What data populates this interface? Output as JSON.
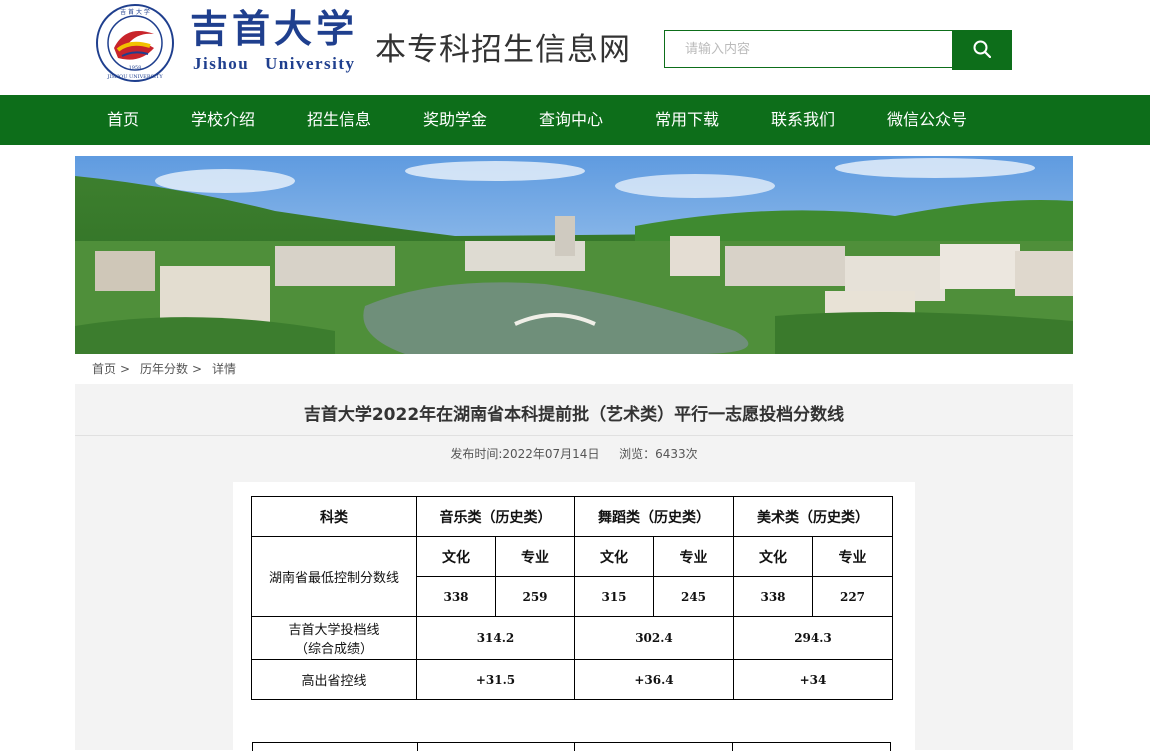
{
  "header": {
    "logo_cn": "吉首大学",
    "logo_en": "Jishou University",
    "site_title": "本专科招生信息网",
    "search_placeholder": "请输入内容",
    "search_icon": "search-icon"
  },
  "nav": {
    "items": [
      "首页",
      "学校介绍",
      "招生信息",
      "奖助学金",
      "查询中心",
      "常用下载",
      "联系我们",
      "微信公众号"
    ]
  },
  "breadcrumb": [
    "首页",
    "历年分数",
    "详情"
  ],
  "breadcrumb_separator": ">",
  "article": {
    "title": "吉首大学2022年在湖南省本科提前批（艺术类）平行一志愿投档分数线",
    "publish_label": "发布时间:",
    "publish_date": "2022年07月14日",
    "views_label": "浏览：",
    "views_count": "6433",
    "views_unit": "次"
  },
  "score_table": {
    "col_header": "科类",
    "categories": [
      "音乐类（历史类）",
      "舞蹈类（历史类）",
      "美术类（历史类）"
    ],
    "subjects": [
      "文化",
      "专业"
    ],
    "min_control_label": "湖南省最低控制分数线",
    "min_control_scores": [
      "338",
      "259",
      "315",
      "245",
      "338",
      "227"
    ],
    "admission_label_1": "吉首大学投档线",
    "admission_label_2": "（综合成绩）",
    "admission_scores": [
      "314.2",
      "302.4",
      "294.3"
    ],
    "above_label": "高出省控线",
    "above_scores": [
      "+31.5",
      "+36.4",
      "+34"
    ]
  },
  "colors": {
    "brand_green": "#0d6e1a",
    "logo_blue": "#1f3f8e",
    "content_bg": "#f3f3f3"
  }
}
